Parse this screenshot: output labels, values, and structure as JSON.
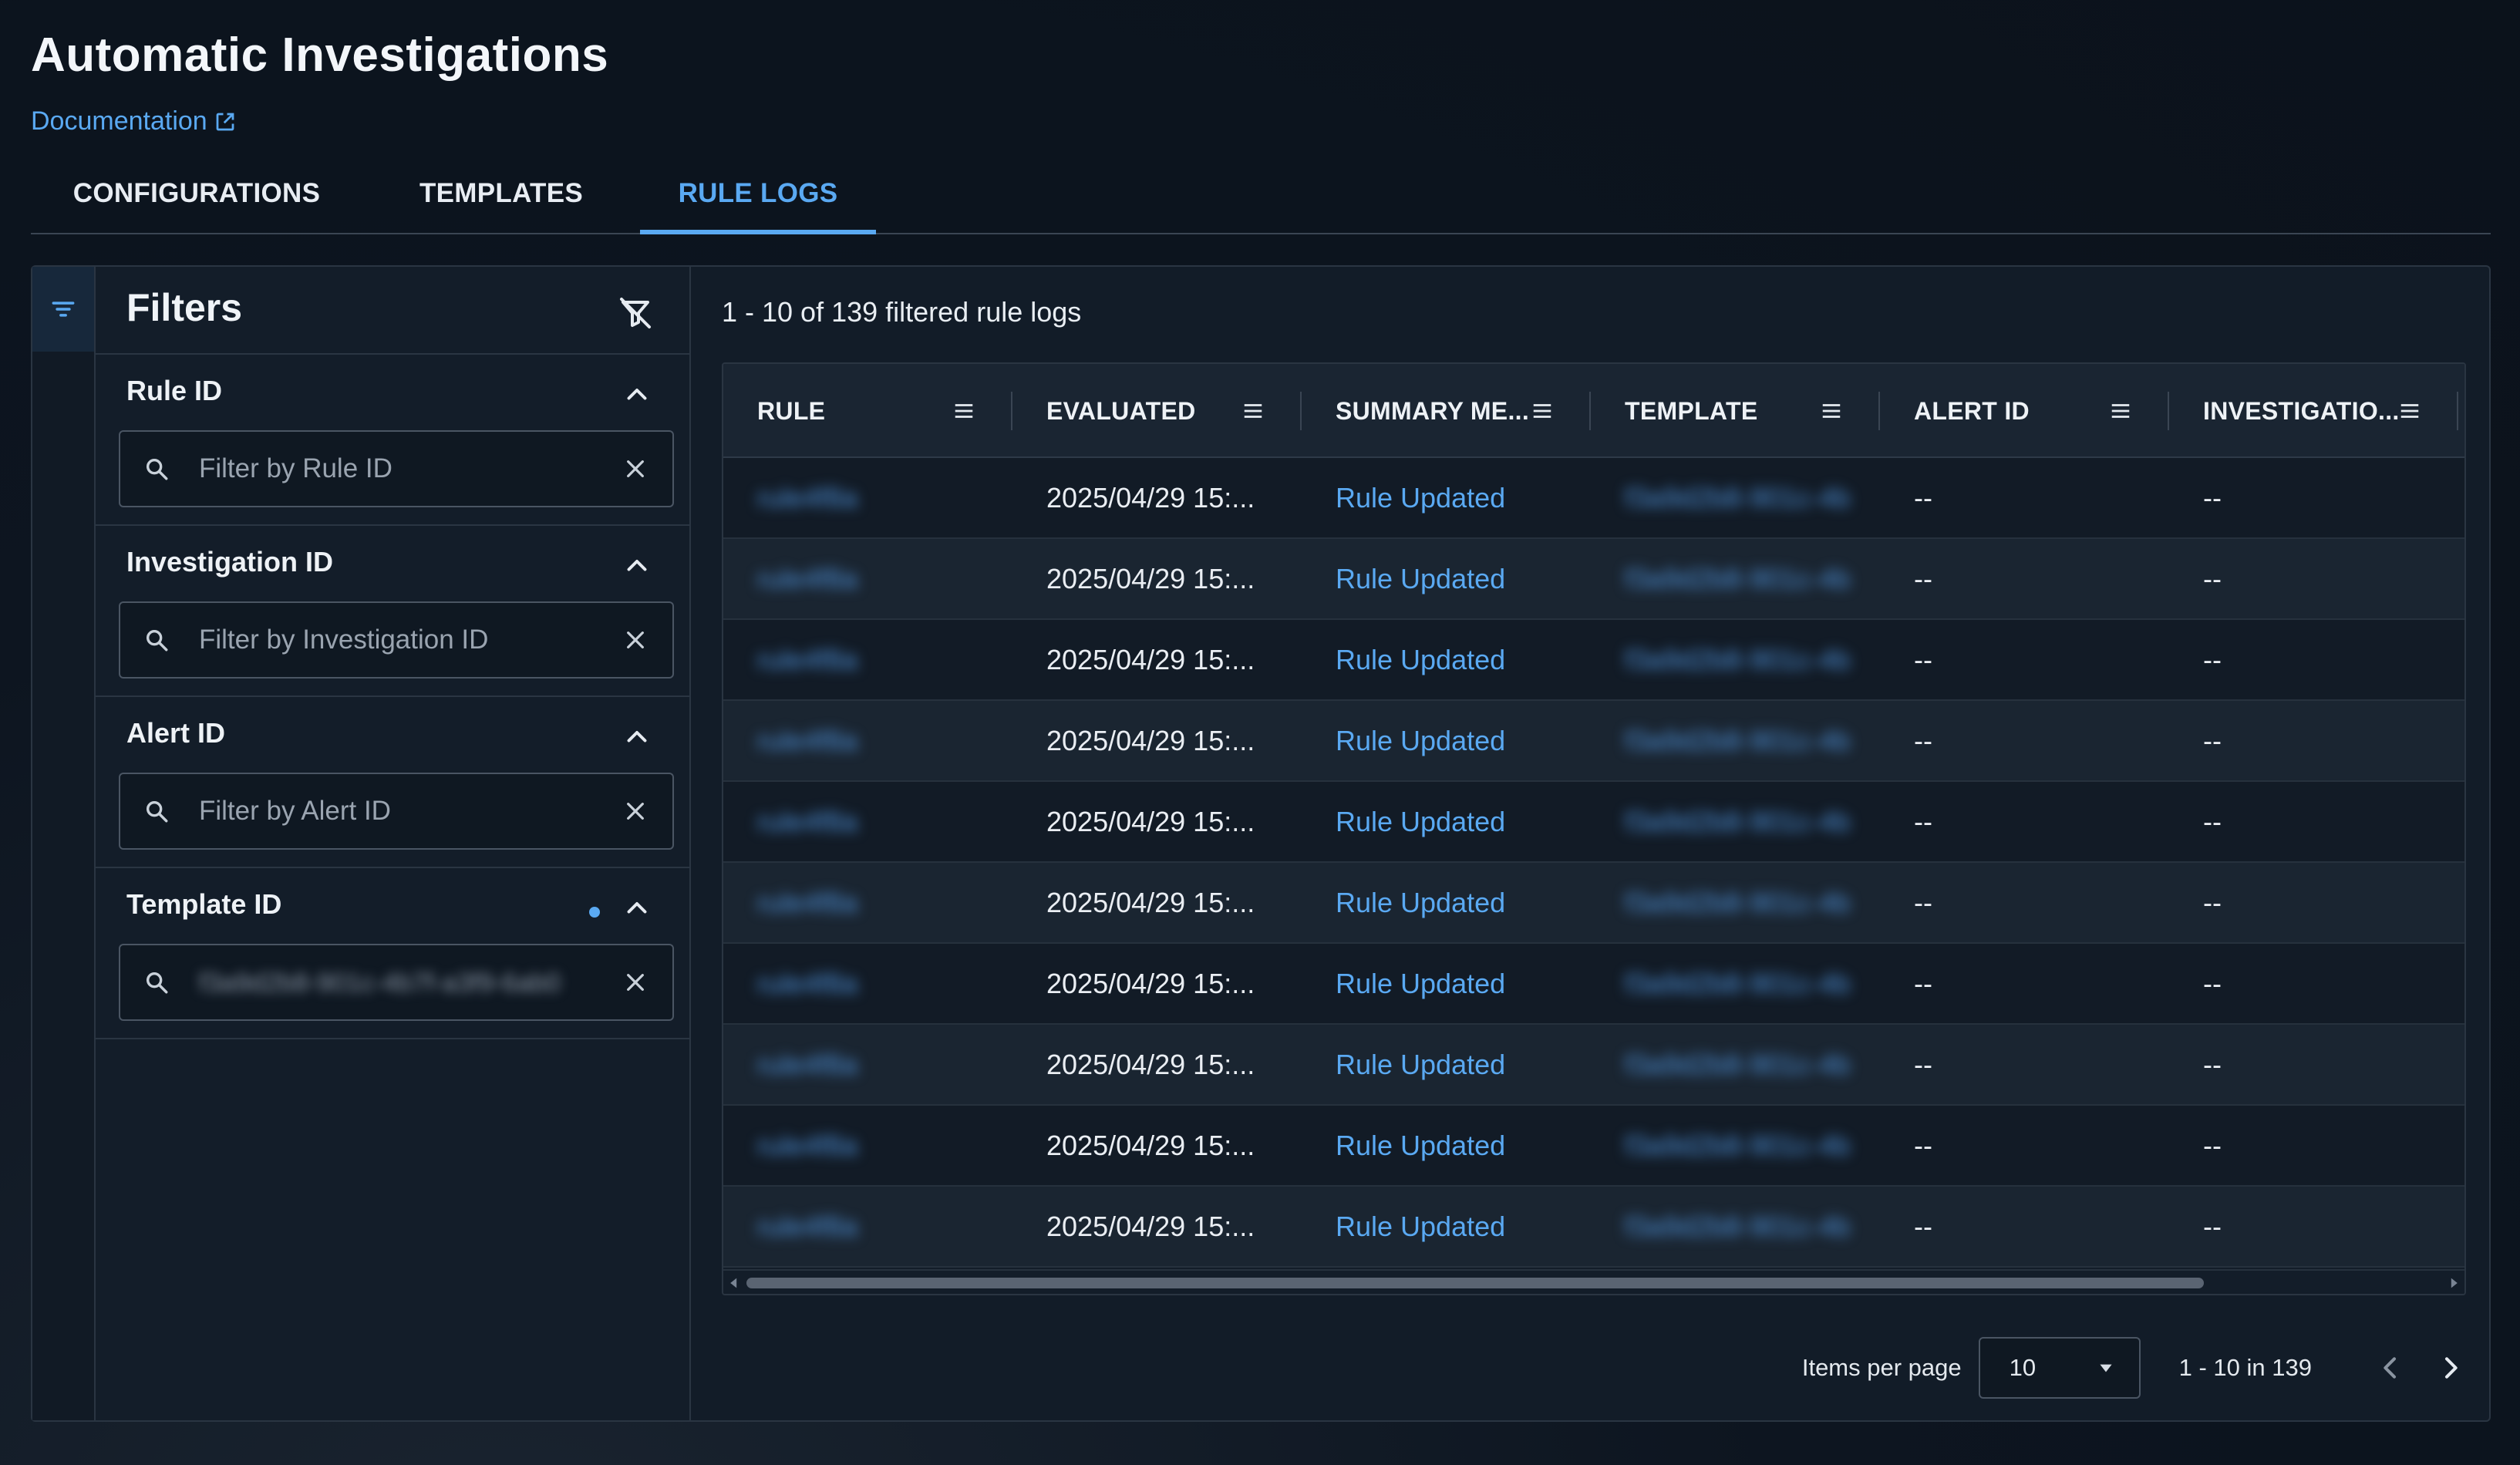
{
  "header": {
    "title": "Automatic Investigations",
    "doc_link": "Documentation"
  },
  "tabs": [
    {
      "label": "CONFIGURATIONS",
      "active": false
    },
    {
      "label": "TEMPLATES",
      "active": false
    },
    {
      "label": "RULE LOGS",
      "active": true
    }
  ],
  "filters": {
    "title": "Filters",
    "sections": [
      {
        "label": "Rule ID",
        "placeholder": "Filter by Rule ID",
        "value": ""
      },
      {
        "label": "Investigation ID",
        "placeholder": "Filter by Investigation ID",
        "value": ""
      },
      {
        "label": "Alert ID",
        "placeholder": "Filter by Alert ID",
        "value": ""
      },
      {
        "label": "Template ID",
        "placeholder": "",
        "value": "f3a9d2b8-901c-4b7f-a3f9-6ab0"
      }
    ]
  },
  "results": {
    "count_text": "1 - 10 of 139 filtered rule logs"
  },
  "table": {
    "columns": [
      "RULE",
      "EVALUATED",
      "SUMMARY ME...",
      "TEMPLATE",
      "ALERT ID",
      "INVESTIGATIO..."
    ],
    "rows": [
      {
        "rule": "rule4f8a",
        "evaluated": "2025/04/29 15:...",
        "summary": "Rule Updated",
        "template": "f3a9d2b8-901c-4b",
        "alert_id": "--",
        "investigation": "--"
      },
      {
        "rule": "rule4f8a",
        "evaluated": "2025/04/29 15:...",
        "summary": "Rule Updated",
        "template": "f3a9d2b8-901c-4b",
        "alert_id": "--",
        "investigation": "--"
      },
      {
        "rule": "rule4f8a",
        "evaluated": "2025/04/29 15:...",
        "summary": "Rule Updated",
        "template": "f3a9d2b8-901c-4b",
        "alert_id": "--",
        "investigation": "--"
      },
      {
        "rule": "rule4f8a",
        "evaluated": "2025/04/29 15:...",
        "summary": "Rule Updated",
        "template": "f3a9d2b8-901c-4b",
        "alert_id": "--",
        "investigation": "--"
      },
      {
        "rule": "rule4f8a",
        "evaluated": "2025/04/29 15:...",
        "summary": "Rule Updated",
        "template": "f3a9d2b8-901c-4b",
        "alert_id": "--",
        "investigation": "--"
      },
      {
        "rule": "rule4f8a",
        "evaluated": "2025/04/29 15:...",
        "summary": "Rule Updated",
        "template": "f3a9d2b8-901c-4b",
        "alert_id": "--",
        "investigation": "--"
      },
      {
        "rule": "rule4f8a",
        "evaluated": "2025/04/29 15:...",
        "summary": "Rule Updated",
        "template": "f3a9d2b8-901c-4b",
        "alert_id": "--",
        "investigation": "--"
      },
      {
        "rule": "rule4f8a",
        "evaluated": "2025/04/29 15:...",
        "summary": "Rule Updated",
        "template": "f3a9d2b8-901c-4b",
        "alert_id": "--",
        "investigation": "--"
      },
      {
        "rule": "rule4f8a",
        "evaluated": "2025/04/29 15:...",
        "summary": "Rule Updated",
        "template": "f3a9d2b8-901c-4b",
        "alert_id": "--",
        "investigation": "--"
      },
      {
        "rule": "rule4f8a",
        "evaluated": "2025/04/29 15:...",
        "summary": "Rule Updated",
        "template": "f3a9d2b8-901c-4b",
        "alert_id": "--",
        "investigation": "--"
      }
    ]
  },
  "pagination": {
    "items_per_page_label": "Items per page",
    "items_per_page": "10",
    "range": "1 - 10 in 139"
  },
  "colors": {
    "accent": "#5aa9f2",
    "background": "#0d1520",
    "panel": "#121c28"
  },
  "icons": [
    "filter-icon",
    "filter-clear-icon",
    "chevron-up-icon",
    "search-icon",
    "close-icon",
    "column-menu-icon",
    "caret-down-icon",
    "chevron-left-icon",
    "chevron-right-icon",
    "external-link-icon"
  ]
}
